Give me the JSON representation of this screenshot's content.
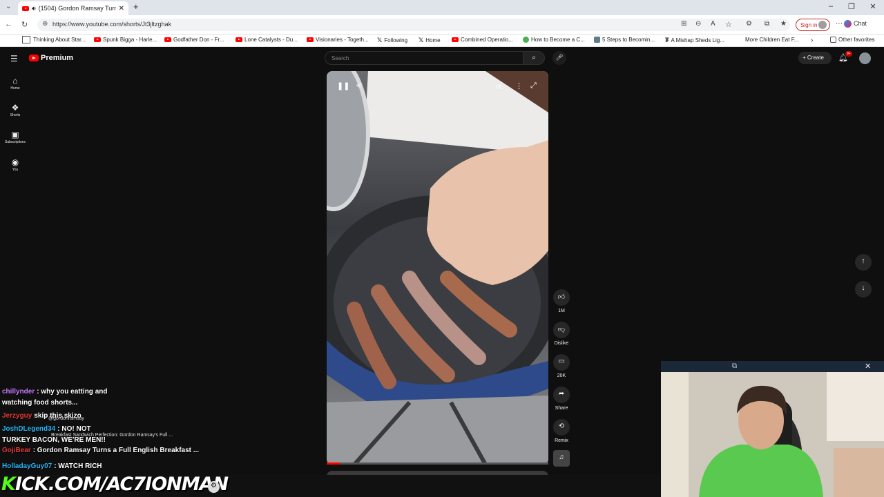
{
  "browser": {
    "tab_title": "(1504) Gordon Ramsay Turn",
    "url": "https://www.youtube.com/shorts/Jt3jltzghak",
    "signin_label": "Sign in",
    "chat_label": "Chat",
    "bookmarks": [
      {
        "label": "Thinking About Star...",
        "color": "#333333"
      },
      {
        "label": "Spunk Bigga - Harle...",
        "color": "#cc0000"
      },
      {
        "label": "Godfather Don - Fr...",
        "color": "#cc0000"
      },
      {
        "label": "Lone Catalysts - Du...",
        "color": "#cc0000"
      },
      {
        "label": "Visionaries - Togeth...",
        "color": "#cc0000"
      },
      {
        "label": "Following",
        "color": "#000000"
      },
      {
        "label": "Home",
        "color": "#000000"
      },
      {
        "label": "Combined Operatio...",
        "color": "#cc0000"
      },
      {
        "label": "How to Become a C...",
        "color": "#4caf50"
      },
      {
        "label": "5 Steps to Becomin...",
        "color": "#607d8b"
      },
      {
        "label": "A Mishap Sheds Lig...",
        "color": "#222222"
      },
      {
        "label": "More Children Eat F...",
        "color": "#ffffff"
      }
    ],
    "other_favorites": "Other favorites"
  },
  "youtube": {
    "logo_text": "Premium",
    "search_placeholder": "Search",
    "create_label": "Create",
    "notif_badge": "9+",
    "sidebar": [
      {
        "label": "Home",
        "icon": "⌂"
      },
      {
        "label": "Shorts",
        "icon": "❖"
      },
      {
        "label": "Subscriptions",
        "icon": "▣"
      },
      {
        "label": "You",
        "icon": "◉"
      }
    ],
    "actions": {
      "like_count": "1M",
      "dislike_label": "Dislike",
      "comments_count": "20K",
      "share_label": "Share",
      "remix_label": "Remix"
    },
    "progress": 0.06
  },
  "stream": {
    "chat": [
      {
        "user": "chillynder",
        "color": "#c77dff",
        "text": ": why you eatting and"
      },
      {
        "user": "",
        "color": "#ffffff",
        "text": "watching food shorts..."
      },
      {
        "user": "Jerzyguy",
        "color": "#e53935",
        "text": "skip this skizo"
      },
      {
        "user": "JoshDLegend34",
        "color": "#29b6f6",
        "text": ": NO! NOT"
      },
      {
        "user": "",
        "color": "#ffffff",
        "text": "TURKEY BACON, WE'RE MEN!!"
      },
      {
        "user": "GojiBear",
        "color": "#e53935",
        "text": ": Gordon Ramsay Turns a Full English Breakfast ..."
      },
      {
        "user": "HolladayGuy07",
        "color": "#29b6f6",
        "text": ": WATCH RICH"
      }
    ],
    "overlay_small": "Breakfast Sandwich Perfection: Gordon Ramsay's Full ...",
    "overlay_handle": "@gordonramsay",
    "kick_prefix": "K",
    "kick_text": "ICK.COM/AC7IONMAN"
  }
}
